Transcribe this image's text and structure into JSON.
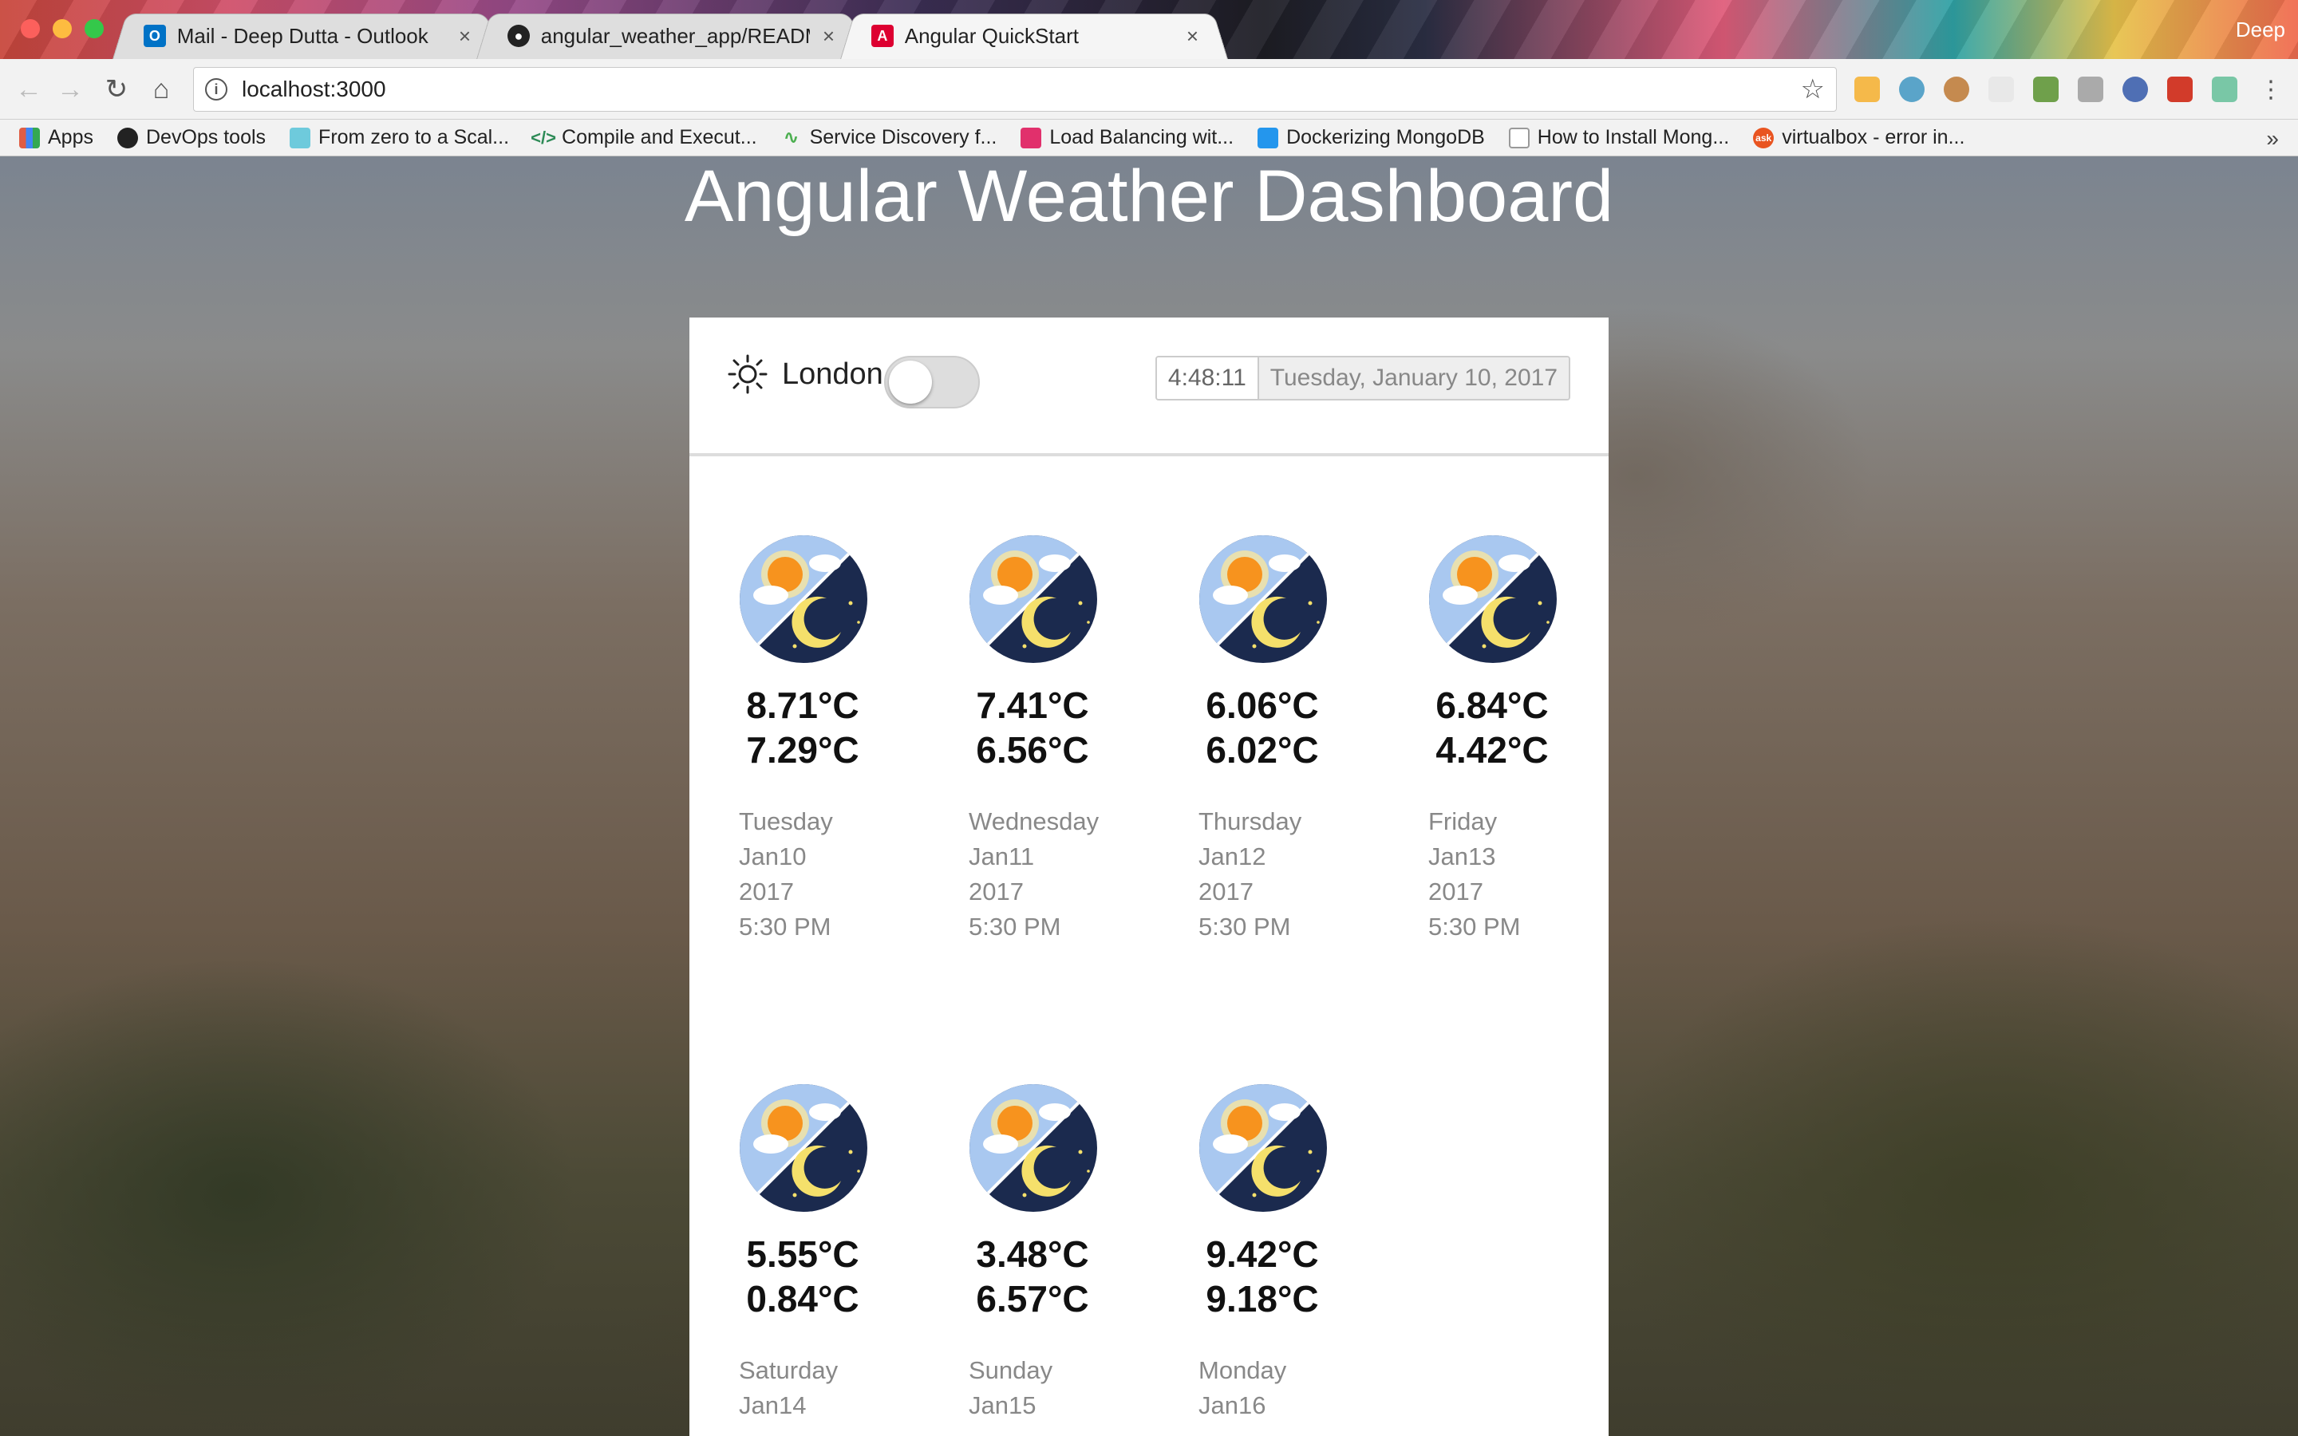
{
  "browser": {
    "tabs": [
      {
        "title": "Mail - Deep Dutta - Outlook",
        "favicon": "outlook-icon",
        "active": false
      },
      {
        "title": "angular_weather_app/README",
        "favicon": "github-icon",
        "active": false
      },
      {
        "title": "Angular QuickStart",
        "favicon": "angular-icon",
        "active": true
      }
    ],
    "close_glyph": "×",
    "profile": "Deep",
    "url": "localhost:3000",
    "bookmarks": [
      {
        "label": "Apps",
        "icon": "apps-grid-icon",
        "color": "#e05d44"
      },
      {
        "label": "DevOps tools",
        "icon": "github-icon",
        "color": "#222222"
      },
      {
        "label": "From zero to a Scal...",
        "icon": "slack-icon",
        "color": "#6ecadc"
      },
      {
        "label": "Compile and Execut...",
        "icon": "code-icon",
        "color": "#2e8b57"
      },
      {
        "label": "Service Discovery f...",
        "icon": "pulse-icon",
        "color": "#4caf50"
      },
      {
        "label": "Load Balancing wit...",
        "icon": "instagram-icon",
        "color": "#e1306c"
      },
      {
        "label": "Dockerizing MongoDB",
        "icon": "docker-icon",
        "color": "#2496ed"
      },
      {
        "label": "How to Install Mong...",
        "icon": "page-icon",
        "color": "#999999"
      },
      {
        "label": "virtualbox - error in...",
        "icon": "askubuntu-icon",
        "color": "#e95420"
      }
    ],
    "more_bookmarks": "»"
  },
  "page": {
    "title": "Angular Weather Dashboard",
    "city": "London",
    "time": "4:48:11",
    "date": "Tuesday, January 10, 2017",
    "toggle_on": false
  },
  "forecast": [
    {
      "temp_high": "8.71°C",
      "temp_low": "7.29°C",
      "day": "Tuesday",
      "date": "Jan10",
      "year": "2017",
      "time": "5:30 PM"
    },
    {
      "temp_high": "7.41°C",
      "temp_low": "6.56°C",
      "day": "Wednesday",
      "date": "Jan11",
      "year": "2017",
      "time": "5:30 PM"
    },
    {
      "temp_high": "6.06°C",
      "temp_low": "6.02°C",
      "day": "Thursday",
      "date": "Jan12",
      "year": "2017",
      "time": "5:30 PM"
    },
    {
      "temp_high": "6.84°C",
      "temp_low": "4.42°C",
      "day": "Friday",
      "date": "Jan13",
      "year": "2017",
      "time": "5:30 PM"
    },
    {
      "temp_high": "5.55°C",
      "temp_low": "0.84°C",
      "day": "Saturday",
      "date": "Jan14",
      "year": "",
      "time": ""
    },
    {
      "temp_high": "3.48°C",
      "temp_low": "6.57°C",
      "day": "Sunday",
      "date": "Jan15",
      "year": "",
      "time": ""
    },
    {
      "temp_high": "9.42°C",
      "temp_low": "9.18°C",
      "day": "Monday",
      "date": "Jan16",
      "year": "",
      "time": ""
    }
  ],
  "colors": {
    "accent_sun": "#f7931e",
    "night_sky": "#1b2a4e",
    "day_sky": "#a9c8f0"
  }
}
